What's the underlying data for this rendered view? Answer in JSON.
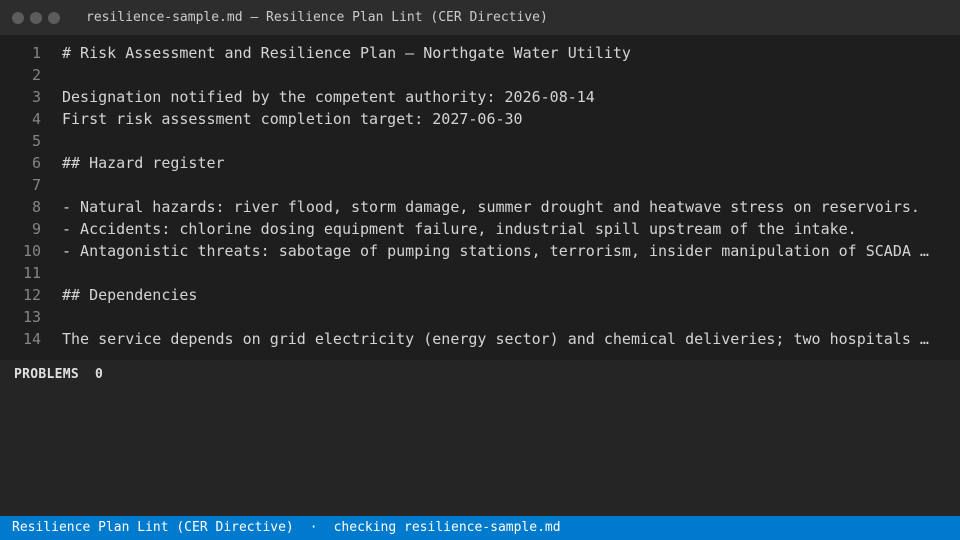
{
  "window": {
    "title": "resilience-sample.md — Resilience Plan Lint (CER Directive)"
  },
  "editor": {
    "lines": [
      {
        "n": "1",
        "text": "# Risk Assessment and Resilience Plan — Northgate Water Utility"
      },
      {
        "n": "2",
        "text": ""
      },
      {
        "n": "3",
        "text": "Designation notified by the competent authority: 2026-08-14"
      },
      {
        "n": "4",
        "text": "First risk assessment completion target: 2027-06-30"
      },
      {
        "n": "5",
        "text": ""
      },
      {
        "n": "6",
        "text": "## Hazard register"
      },
      {
        "n": "7",
        "text": ""
      },
      {
        "n": "8",
        "text": "- Natural hazards: river flood, storm damage, summer drought and heatwave stress on reservoirs."
      },
      {
        "n": "9",
        "text": "- Accidents: chlorine dosing equipment failure, industrial spill upstream of the intake."
      },
      {
        "n": "10",
        "text": "- Antagonistic threats: sabotage of pumping stations, terrorism, insider manipulation of SCADA …"
      },
      {
        "n": "11",
        "text": ""
      },
      {
        "n": "12",
        "text": "## Dependencies"
      },
      {
        "n": "13",
        "text": ""
      },
      {
        "n": "14",
        "text": "The service depends on grid electricity (energy sector) and chemical deliveries; two hospitals …"
      }
    ]
  },
  "panel": {
    "label": "PROBLEMS",
    "count": "0"
  },
  "statusbar": {
    "app": "Resilience Plan Lint (CER Directive)",
    "separator": "·",
    "status": "checking resilience-sample.md"
  },
  "colors": {
    "statusbar_bg": "#007acc",
    "editor_bg": "#1e1e1e",
    "titlebar_bg": "#2d2d2d"
  }
}
